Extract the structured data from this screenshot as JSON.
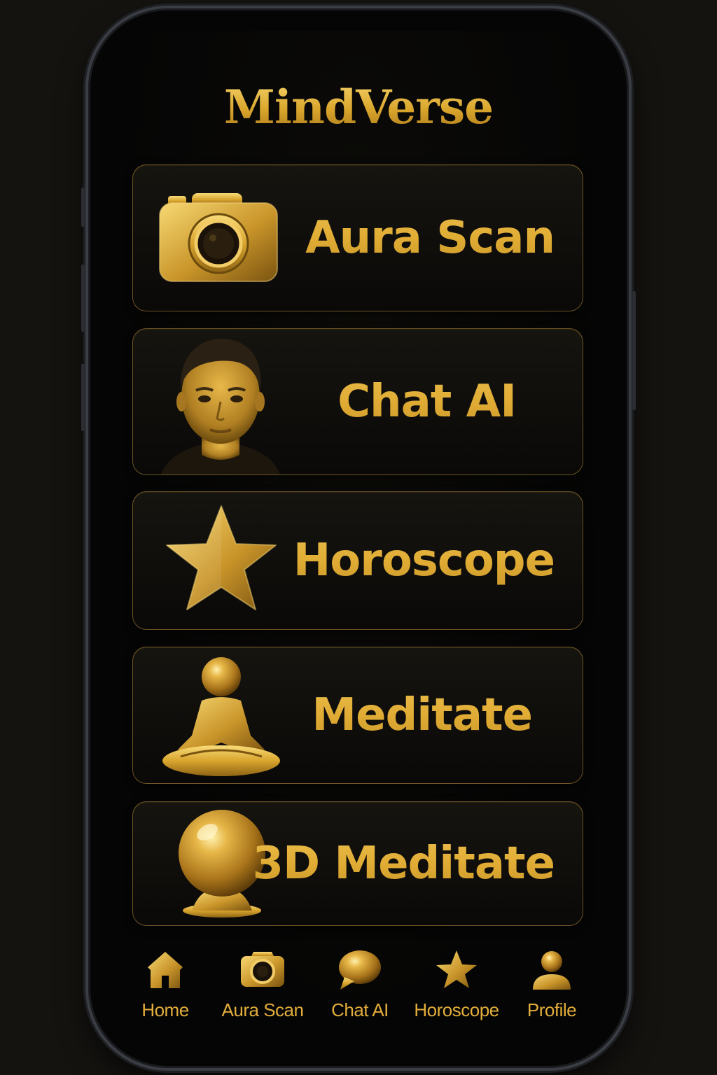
{
  "app": {
    "title": "MindVerse"
  },
  "colors": {
    "gold_light": "#f7d36a",
    "gold_mid": "#e0ac34",
    "gold_dark": "#a8771a",
    "background": "#050505",
    "card_border": "#6e5525"
  },
  "menu": {
    "items": [
      {
        "label": "Aura Scan",
        "icon": "camera-icon"
      },
      {
        "label": "Chat AI",
        "icon": "ai-avatar-portrait"
      },
      {
        "label": "Horoscope",
        "icon": "star-icon"
      },
      {
        "label": "Meditate",
        "icon": "meditation-figure-icon"
      },
      {
        "label": "3D Meditate",
        "icon": "crystal-ball-icon"
      }
    ]
  },
  "tabbar": {
    "items": [
      {
        "label": "Home",
        "icon": "home-icon"
      },
      {
        "label": "Aura Scan",
        "icon": "camera-icon"
      },
      {
        "label": "Chat AI",
        "icon": "chat-bubble-icon"
      },
      {
        "label": "Horoscope",
        "icon": "star-icon"
      },
      {
        "label": "Profile",
        "icon": "profile-icon"
      }
    ]
  }
}
